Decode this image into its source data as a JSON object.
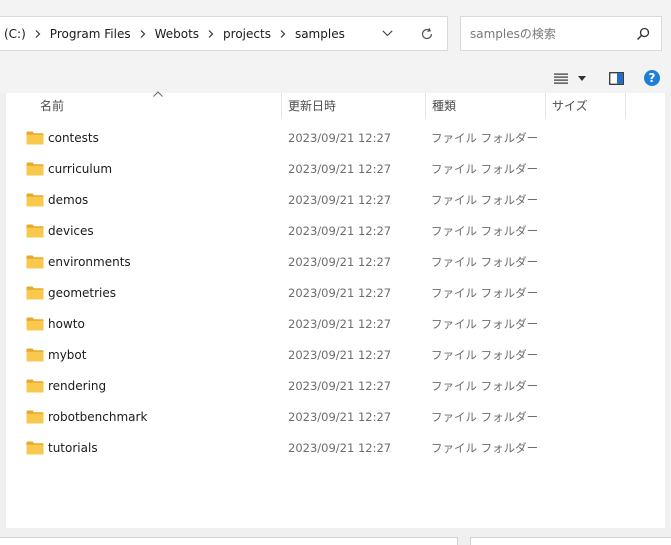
{
  "address_bar": {
    "crumbs": [
      "(C:)",
      "Program Files",
      "Webots",
      "projects",
      "samples"
    ]
  },
  "search": {
    "placeholder": "samplesの検索"
  },
  "columns": {
    "name": "名前",
    "date": "更新日時",
    "type": "種類",
    "size": "サイズ"
  },
  "files": [
    {
      "name": "contests",
      "date": "2023/09/21 12:27",
      "type": "ファイル フォルダー"
    },
    {
      "name": "curriculum",
      "date": "2023/09/21 12:27",
      "type": "ファイル フォルダー"
    },
    {
      "name": "demos",
      "date": "2023/09/21 12:27",
      "type": "ファイル フォルダー"
    },
    {
      "name": "devices",
      "date": "2023/09/21 12:27",
      "type": "ファイル フォルダー"
    },
    {
      "name": "environments",
      "date": "2023/09/21 12:27",
      "type": "ファイル フォルダー"
    },
    {
      "name": "geometries",
      "date": "2023/09/21 12:27",
      "type": "ファイル フォルダー"
    },
    {
      "name": "howto",
      "date": "2023/09/21 12:27",
      "type": "ファイル フォルダー"
    },
    {
      "name": "mybot",
      "date": "2023/09/21 12:27",
      "type": "ファイル フォルダー"
    },
    {
      "name": "rendering",
      "date": "2023/09/21 12:27",
      "type": "ファイル フォルダー"
    },
    {
      "name": "robotbenchmark",
      "date": "2023/09/21 12:27",
      "type": "ファイル フォルダー"
    },
    {
      "name": "tutorials",
      "date": "2023/09/21 12:27",
      "type": "ファイル フォルダー"
    }
  ],
  "toolbar": {
    "view_icon": "list-view-icon",
    "dropdown_icon": "caret-down-icon",
    "preview_icon": "preview-pane-icon",
    "help_icon": "help-icon",
    "help_glyph": "?"
  },
  "colors": {
    "folder": "#f8c94d",
    "folder_dark": "#e6a92a",
    "help_blue": "#1d7fd6",
    "preview_blue": "#1c6fd1"
  }
}
